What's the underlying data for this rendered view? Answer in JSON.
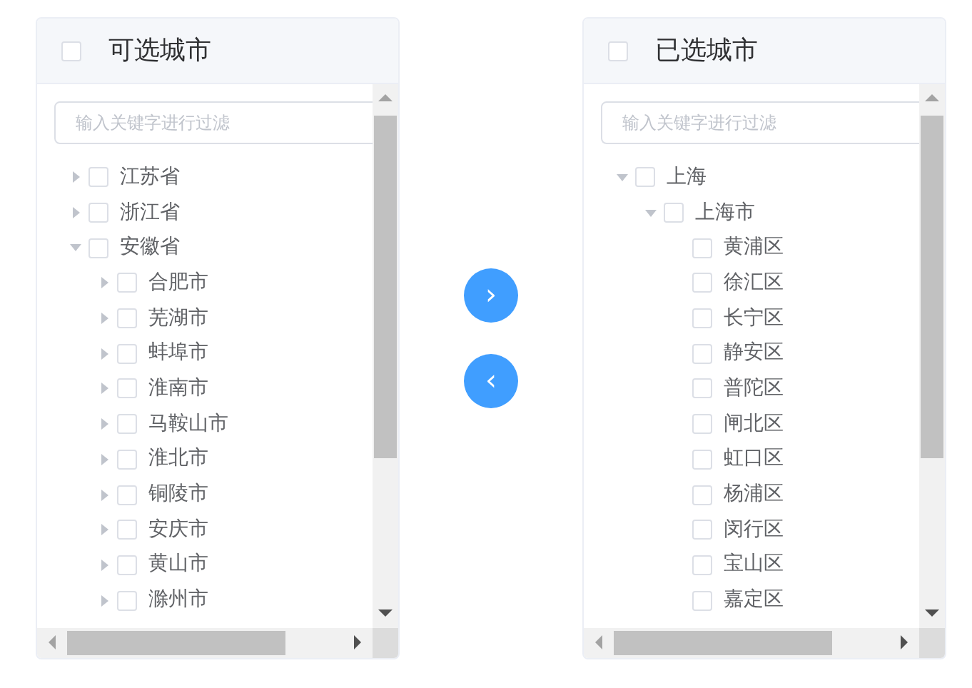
{
  "source_panel": {
    "title": "可选城市",
    "checked": false,
    "filter": {
      "placeholder": "输入关键字进行过滤"
    },
    "tree": [
      {
        "label": "江苏省",
        "kind": "branch",
        "expanded": false,
        "checked": false
      },
      {
        "label": "浙江省",
        "kind": "branch",
        "expanded": false,
        "checked": false
      },
      {
        "label": "安徽省",
        "kind": "branch",
        "expanded": true,
        "checked": false,
        "children": [
          {
            "label": "合肥市",
            "kind": "branch",
            "expanded": false,
            "checked": false
          },
          {
            "label": "芜湖市",
            "kind": "branch",
            "expanded": false,
            "checked": false
          },
          {
            "label": "蚌埠市",
            "kind": "branch",
            "expanded": false,
            "checked": false
          },
          {
            "label": "淮南市",
            "kind": "branch",
            "expanded": false,
            "checked": false
          },
          {
            "label": "马鞍山市",
            "kind": "branch",
            "expanded": false,
            "checked": false
          },
          {
            "label": "淮北市",
            "kind": "branch",
            "expanded": false,
            "checked": false
          },
          {
            "label": "铜陵市",
            "kind": "branch",
            "expanded": false,
            "checked": false
          },
          {
            "label": "安庆市",
            "kind": "branch",
            "expanded": false,
            "checked": false
          },
          {
            "label": "黄山市",
            "kind": "branch",
            "expanded": false,
            "checked": false
          },
          {
            "label": "滁州市",
            "kind": "branch",
            "expanded": false,
            "checked": false
          }
        ]
      }
    ]
  },
  "transfer_buttons": [
    {
      "label": "›"
    },
    {
      "label": "‹"
    }
  ],
  "target_panel": {
    "title": "已选城市",
    "checked": false,
    "filter": {
      "placeholder": "输入关键字进行过滤"
    },
    "tree": [
      {
        "label": "上海",
        "kind": "branch",
        "expanded": true,
        "checked": false,
        "children": [
          {
            "label": "上海市",
            "kind": "branch",
            "expanded": true,
            "checked": false,
            "children": [
              {
                "label": "黄浦区",
                "kind": "leaf",
                "checked": false
              },
              {
                "label": "徐汇区",
                "kind": "leaf",
                "checked": false
              },
              {
                "label": "长宁区",
                "kind": "leaf",
                "checked": false
              },
              {
                "label": "静安区",
                "kind": "leaf",
                "checked": false
              },
              {
                "label": "普陀区",
                "kind": "leaf",
                "checked": false
              },
              {
                "label": "闸北区",
                "kind": "leaf",
                "checked": false
              },
              {
                "label": "虹口区",
                "kind": "leaf",
                "checked": false
              },
              {
                "label": "杨浦区",
                "kind": "leaf",
                "checked": false
              },
              {
                "label": "闵行区",
                "kind": "leaf",
                "checked": false
              },
              {
                "label": "宝山区",
                "kind": "leaf",
                "checked": false
              },
              {
                "label": "嘉定区",
                "kind": "leaf",
                "checked": false
              }
            ]
          }
        ]
      }
    ]
  }
}
